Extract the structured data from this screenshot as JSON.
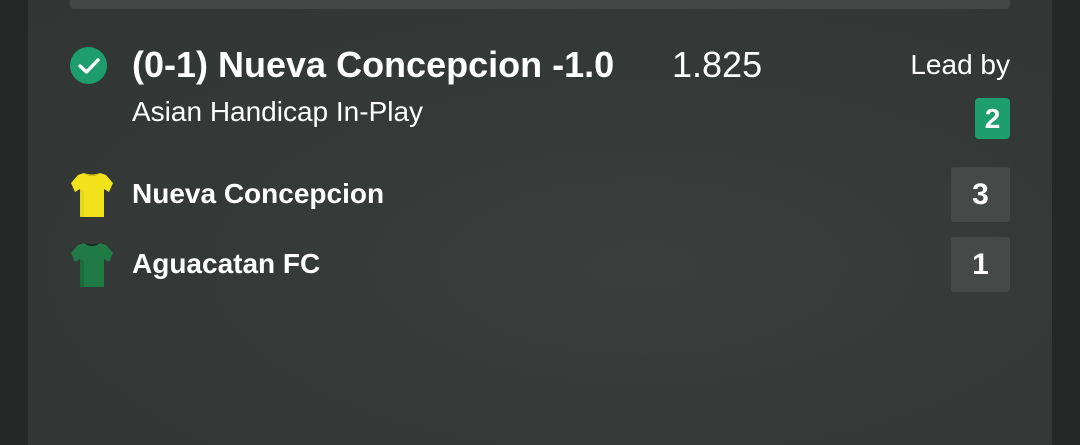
{
  "bet": {
    "selection": "(0-1) Nueva Concepcion -1.0",
    "odds": "1.825",
    "market": "Asian Handicap In-Play",
    "status": "won",
    "lead_label": "Lead by",
    "lead_value": "2"
  },
  "teams": [
    {
      "name": "Nueva Concepcion",
      "score": "3",
      "shirt_color": "#f2e21c"
    },
    {
      "name": "Aguacatan FC",
      "score": "1",
      "shirt_color": "#1f7a45"
    }
  ],
  "colors": {
    "accent_green": "#1e9e6e",
    "background": "#242927",
    "card": "#353937",
    "score_box": "#454947",
    "text": "#ffffff"
  }
}
